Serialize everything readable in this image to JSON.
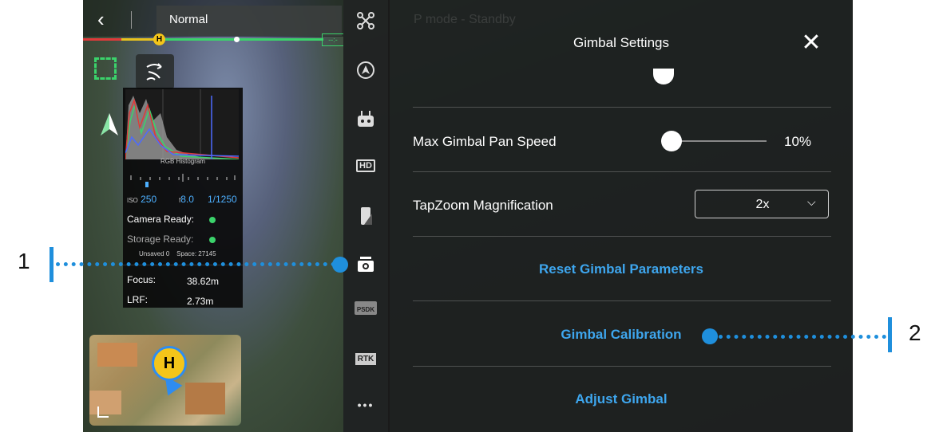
{
  "header": {
    "back_icon": "chevron-left-icon",
    "flight_mode": "Normal",
    "home_marker": "H"
  },
  "camera_tools": {
    "focus_icon": "focus-frame-icon",
    "track_icon": "smart-track-icon",
    "compass_icon": "compass-icon"
  },
  "histogram": {
    "title": "RGB Histogram",
    "iso_label": "ISO",
    "iso_value": "250",
    "aperture_label": "f",
    "aperture_value": "8.0",
    "shutter_value": "1/1250",
    "camera_ready_label": "Camera Ready:",
    "storage_ready_label": "Storage Ready:",
    "unsaved_label": "Unsaved",
    "unsaved_value": "0",
    "space_label": "Space:",
    "space_value": "27145",
    "focus_label": "Focus:",
    "focus_value": "38.62m",
    "lrf_label": "LRF:",
    "lrf_value": "2.73m"
  },
  "map": {
    "home_label": "H",
    "corner_icon": "minimize-icon"
  },
  "icon_strip": {
    "items": [
      {
        "name": "aircraft-icon",
        "label": ""
      },
      {
        "name": "obstacle-avoidance-icon",
        "label": ""
      },
      {
        "name": "remote-controller-icon",
        "label": ""
      },
      {
        "name": "hd-transmission-icon",
        "label": "HD"
      },
      {
        "name": "battery-icon",
        "label": ""
      },
      {
        "name": "gimbal-camera-icon",
        "label": ""
      },
      {
        "name": "psdk-icon",
        "label": "PSDK"
      },
      {
        "name": "rtk-icon",
        "label": "RTK"
      },
      {
        "name": "more-icon",
        "label": "•••"
      }
    ]
  },
  "background_status": {
    "mode_text": "P mode - Standby"
  },
  "panel": {
    "title": "Gimbal Settings",
    "close_icon": "close-icon",
    "max_pan_speed": {
      "label": "Max Gimbal Pan Speed",
      "value": "10%",
      "level": 0.1
    },
    "tapzoom": {
      "label": "TapZoom Magnification",
      "value": "2x"
    },
    "reset_label": "Reset Gimbal Parameters",
    "calibration_label": "Gimbal Calibration",
    "adjust_label": "Adjust Gimbal"
  },
  "callouts": [
    {
      "number": "1"
    },
    {
      "number": "2"
    }
  ],
  "colors": {
    "accent_blue": "#3ea6ee",
    "callout_blue": "#1f8fdc",
    "status_green": "#3bd36b",
    "home_yellow": "#f4c51a"
  }
}
